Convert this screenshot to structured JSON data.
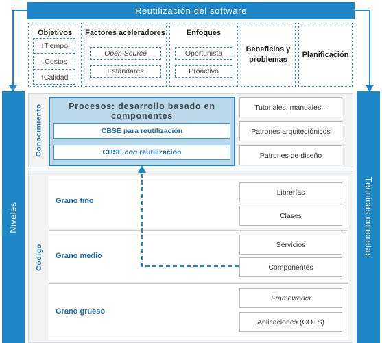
{
  "title": "Reutilización del software",
  "left_bar": "Niveles",
  "right_bar": "Técnicas concretas",
  "top_row": {
    "objetivos": {
      "title": "Objetivos",
      "items": [
        "↓Tiempo",
        "↓Costos",
        "↑Calidad"
      ]
    },
    "factores": {
      "title": "Factores aceleradores",
      "items": [
        "Open Source",
        "Estándares"
      ]
    },
    "enfoques": {
      "title": "Enfoques",
      "items": [
        "Oportunista",
        "Proactivo"
      ]
    },
    "beneficios": "Beneficios y problemas",
    "planificacion": "Planificación"
  },
  "conocimiento": {
    "label": "Conocimiento",
    "process_title": "Procesos: desarrollo basado en componentes",
    "cbse_para": "CBSE para reutilización",
    "cbse_con_prefix": "CBSE ",
    "cbse_con_italic": "con",
    "cbse_con_suffix": " reutilización",
    "right_items": [
      "Tutoriales, manuales...",
      "Patrones arquitectónicos",
      "Patrones de diseño"
    ]
  },
  "codigo": {
    "label": "Código",
    "rows": [
      {
        "grain": "Grano fino",
        "items": [
          "Librerías",
          "Clases"
        ]
      },
      {
        "grain": "Grano medio",
        "items": [
          "Servicios",
          "Componentes"
        ]
      },
      {
        "grain": "Grano grueso",
        "items": [
          "Frameworks",
          "Aplicaciones (COTS)"
        ]
      }
    ]
  },
  "colors": {
    "accent": "#1f87c6",
    "process_fill": "#b9d9eb",
    "grain_text": "#1f6fae"
  }
}
